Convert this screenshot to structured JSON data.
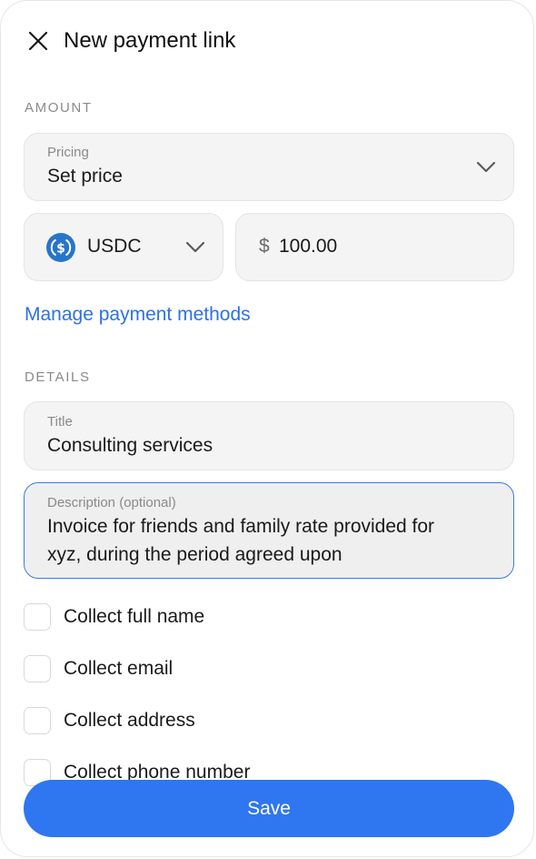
{
  "header": {
    "title": "New payment link"
  },
  "amount_section": {
    "label": "AMOUNT",
    "pricing": {
      "label": "Pricing",
      "value": "Set price"
    },
    "currency": {
      "code": "USDC",
      "icon": "usdc-coin-icon"
    },
    "amount": {
      "symbol": "$",
      "value": "100.00"
    },
    "manage_link": "Manage payment methods"
  },
  "details_section": {
    "label": "DETAILS",
    "title_field": {
      "label": "Title",
      "value": "Consulting services"
    },
    "description_field": {
      "label": "Description (optional)",
      "value_line1": "Invoice for friends and family rate provided for",
      "value_line2": "xyz, during the period agreed upon"
    }
  },
  "checkboxes": [
    {
      "label": "Collect full name",
      "checked": false
    },
    {
      "label": "Collect email",
      "checked": false
    },
    {
      "label": "Collect address",
      "checked": false
    },
    {
      "label": "Collect phone number",
      "checked": false
    }
  ],
  "footer": {
    "save_label": "Save"
  },
  "colors": {
    "accent": "#2f76f1",
    "link": "#2a72e8",
    "focus_border": "#3b7be8",
    "usdc_blue": "#2775ca"
  }
}
